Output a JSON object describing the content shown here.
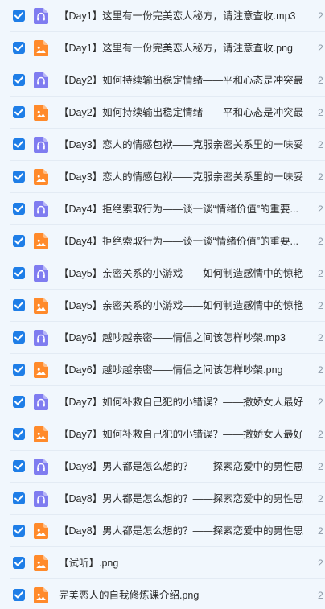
{
  "colors": {
    "background": "#f1f7fd",
    "checkbox": "#1f7ee7",
    "audio_icon": "#7f7cf0",
    "image_icon": "#ff8a2b"
  },
  "files": [
    {
      "name": "【Day1】这里有一份完美恋人秘方，请注意查收.mp3",
      "type": "audio",
      "checked": true,
      "trailing": "2"
    },
    {
      "name": "【Day1】这里有一份完美恋人秘方，请注意查收.png",
      "type": "image",
      "checked": true,
      "trailing": "2"
    },
    {
      "name": "【Day2】如何持续输出稳定情绪——平和心态是冲突最...",
      "type": "audio",
      "checked": true,
      "trailing": "2"
    },
    {
      "name": "【Day2】如何持续输出稳定情绪——平和心态是冲突最...",
      "type": "image",
      "checked": true,
      "trailing": "2"
    },
    {
      "name": "【Day3】恋人的情感包袱——克服亲密关系里的一味妥...",
      "type": "audio",
      "checked": true,
      "trailing": "2"
    },
    {
      "name": "【Day3】恋人的情感包袱——克服亲密关系里的一味妥...",
      "type": "image",
      "checked": true,
      "trailing": "2"
    },
    {
      "name": "【Day4】拒绝索取行为——谈一谈“情绪价值”的重要...",
      "type": "audio",
      "checked": true,
      "trailing": "2"
    },
    {
      "name": "【Day4】拒绝索取行为——谈一谈“情绪价值”的重要...",
      "type": "image",
      "checked": true,
      "trailing": "2"
    },
    {
      "name": "【Day5】亲密关系的小游戏——如何制造感情中的惊艳...",
      "type": "audio",
      "checked": true,
      "trailing": "2"
    },
    {
      "name": "【Day5】亲密关系的小游戏——如何制造感情中的惊艳...",
      "type": "image",
      "checked": true,
      "trailing": "2"
    },
    {
      "name": "【Day6】越吵越亲密——情侣之间该怎样吵架.mp3",
      "type": "audio",
      "checked": true,
      "trailing": "2"
    },
    {
      "name": "【Day6】越吵越亲密——情侣之间该怎样吵架.png",
      "type": "image",
      "checked": true,
      "trailing": "2"
    },
    {
      "name": "【Day7】如何补救自己犯的小错误？——撒娇女人最好...",
      "type": "audio",
      "checked": true,
      "trailing": "2"
    },
    {
      "name": "【Day7】如何补救自己犯的小错误？——撒娇女人最好...",
      "type": "image",
      "checked": true,
      "trailing": "2"
    },
    {
      "name": "【Day8】男人都是怎么想的？——探索恋爱中的男性思...",
      "type": "audio",
      "checked": true,
      "trailing": "2"
    },
    {
      "name": "【Day8】男人都是怎么想的？——探索恋爱中的男性思...",
      "type": "audio",
      "checked": true,
      "trailing": "2"
    },
    {
      "name": "【Day8】男人都是怎么想的？——探索恋爱中的男性思...",
      "type": "image",
      "checked": true,
      "trailing": "2"
    },
    {
      "name": "【试听】.png",
      "type": "image",
      "checked": true,
      "trailing": "2"
    },
    {
      "name": "完美恋人的自我修炼课介绍.png",
      "type": "image",
      "checked": true,
      "trailing": "2"
    }
  ]
}
